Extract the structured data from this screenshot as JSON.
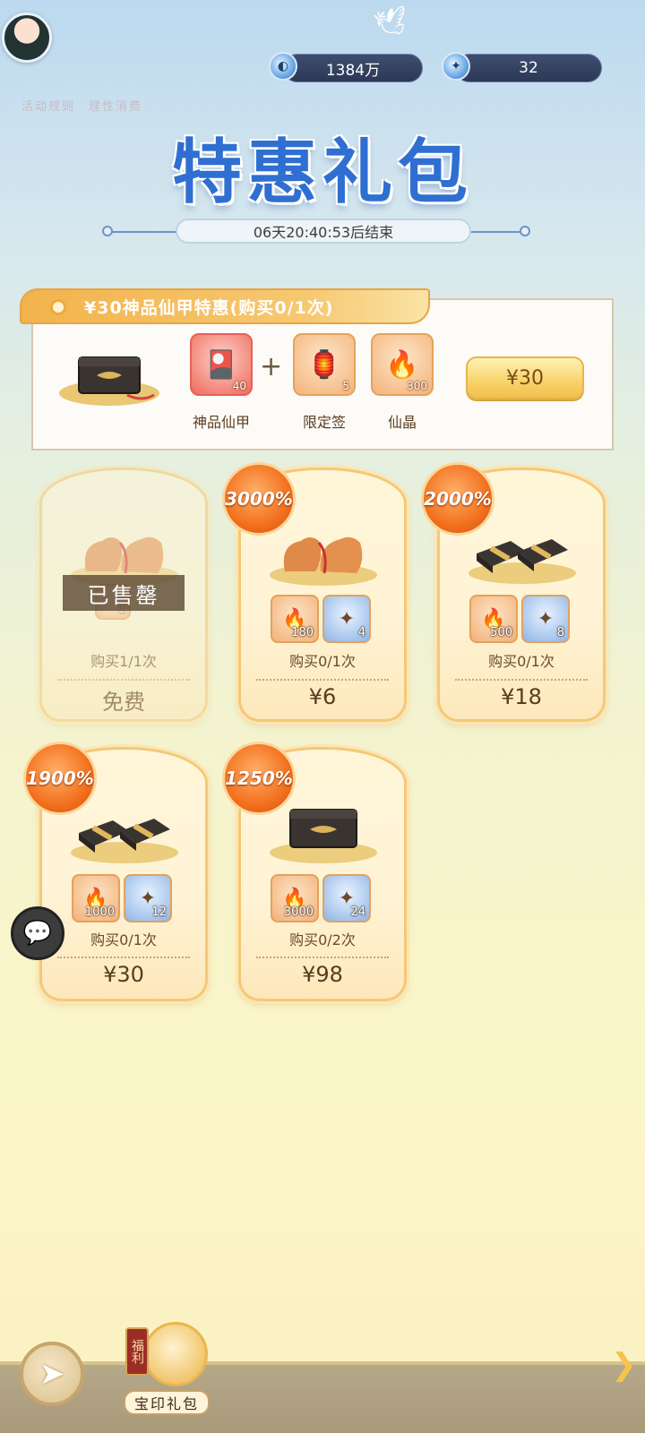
{
  "header": {
    "resources": [
      {
        "icon": "spirit-coin-icon",
        "value": "1384万"
      },
      {
        "icon": "jade-ticket-icon",
        "value": "32"
      }
    ],
    "faint_text": "活动规则　理性消费"
  },
  "title": "特惠礼包",
  "timer": "06天20:40:53后结束",
  "featured": {
    "tab_title": "¥30神品仙甲特惠(购买0/1次)",
    "items": [
      {
        "name": "神品仙甲",
        "count": "40",
        "icon": "armor-card-icon"
      },
      {
        "name": "限定签",
        "count": "5",
        "icon": "limited-lot-icon"
      },
      {
        "name": "仙晶",
        "count": "300",
        "icon": "immortal-crystal-icon"
      }
    ],
    "price": "¥30"
  },
  "packs": [
    {
      "status": "已售罄",
      "items": [
        {
          "count": "1"
        }
      ],
      "limit": "购买1/1次",
      "price": "免费",
      "art": "pouch"
    },
    {
      "badge": "3000%",
      "items": [
        {
          "count": "180"
        },
        {
          "count": "4"
        }
      ],
      "limit": "购买0/1次",
      "price": "¥6",
      "art": "pouch"
    },
    {
      "badge": "2000%",
      "items": [
        {
          "count": "500"
        },
        {
          "count": "8"
        }
      ],
      "limit": "购买0/1次",
      "price": "¥18",
      "art": "bundle"
    },
    {
      "badge": "1900%",
      "items": [
        {
          "count": "1000"
        },
        {
          "count": "12"
        }
      ],
      "limit": "购买0/1次",
      "price": "¥30",
      "art": "bundle"
    },
    {
      "badge": "1250%",
      "items": [
        {
          "count": "3000"
        },
        {
          "count": "24"
        }
      ],
      "limit": "购买0/2次",
      "price": "¥98",
      "art": "chest"
    }
  ],
  "bottom_nav": {
    "tab_tag": "福利",
    "tab_label": "宝印礼包"
  },
  "colors": {
    "title_blue": "#2f6fd1",
    "badge_orange": "#f2711e",
    "price_gold": "#f7d36a"
  }
}
